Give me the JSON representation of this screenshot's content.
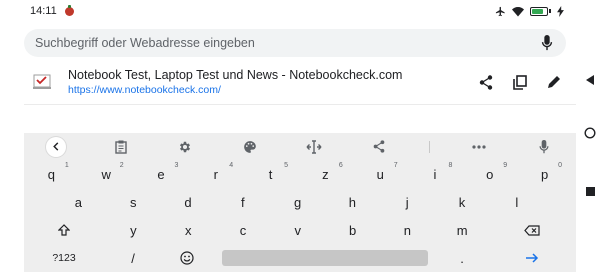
{
  "status_bar": {
    "time": "14:11"
  },
  "search": {
    "placeholder": "Suchbegriff oder Webadresse eingeben"
  },
  "suggestion": {
    "title": "Notebook Test, Laptop Test und News - Notebookcheck.com",
    "url": "https://www.notebookcheck.com/"
  },
  "keyboard": {
    "row1": [
      {
        "key": "q",
        "hint": "1"
      },
      {
        "key": "w",
        "hint": "2"
      },
      {
        "key": "e",
        "hint": "3"
      },
      {
        "key": "r",
        "hint": "4"
      },
      {
        "key": "t",
        "hint": "5"
      },
      {
        "key": "z",
        "hint": "6"
      },
      {
        "key": "u",
        "hint": "7"
      },
      {
        "key": "i",
        "hint": "8"
      },
      {
        "key": "o",
        "hint": "9"
      },
      {
        "key": "p",
        "hint": "0"
      }
    ],
    "row2": [
      "a",
      "s",
      "d",
      "f",
      "g",
      "h",
      "j",
      "k",
      "l"
    ],
    "row3": [
      "y",
      "x",
      "c",
      "v",
      "b",
      "n",
      "m"
    ],
    "row4": {
      "symbols": "?123",
      "slash": "/",
      "period": "."
    }
  },
  "icons": {
    "status": [
      "tomato-icon",
      "airplane-icon",
      "wifi-icon",
      "battery-icon",
      "charging-icon"
    ],
    "toolbar": [
      "back-icon",
      "clipboard-icon",
      "settings-icon",
      "palette-icon",
      "cursor-move-icon",
      "share-icon",
      "more-icon",
      "mic-icon"
    ]
  },
  "colors": {
    "link": "#1a73e8",
    "keyboard_bg": "#eeeeee",
    "url_bar_bg": "#f1f3f4",
    "battery": "#34a853"
  }
}
